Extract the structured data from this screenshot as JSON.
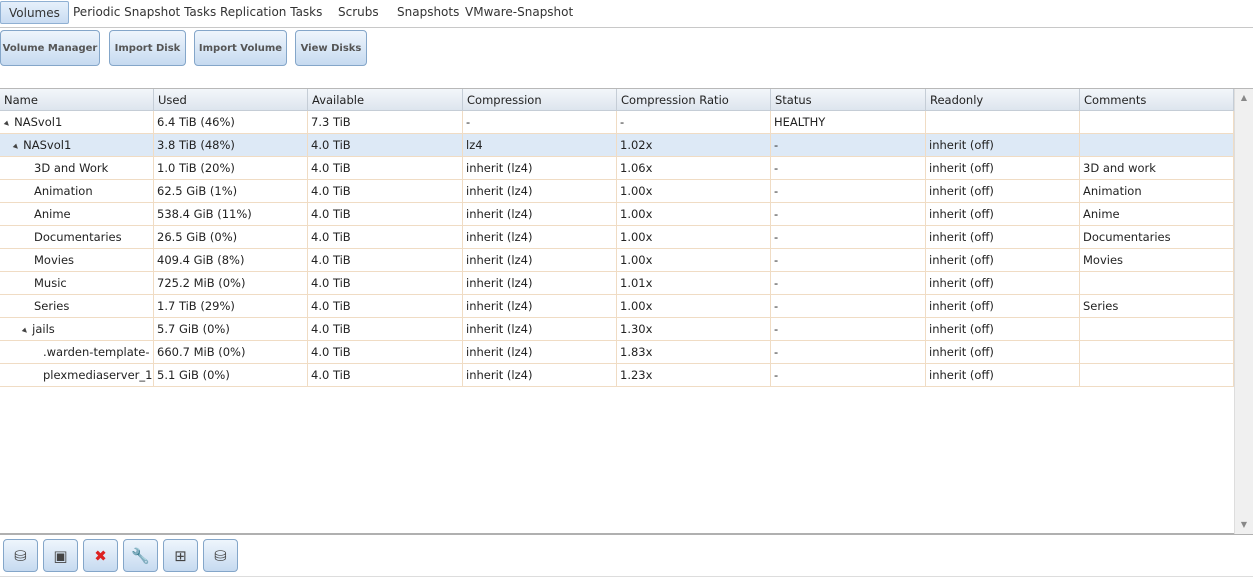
{
  "tabs": [
    "Volumes",
    "Periodic Snapshot Tasks",
    "Replication Tasks",
    "Scrubs",
    "Snapshots",
    "VMware-Snapshot"
  ],
  "buttons": [
    "Volume Manager",
    "Import Disk",
    "Import Volume",
    "View Disks"
  ],
  "columns": [
    "Name",
    "Used",
    "Available",
    "Compression",
    "Compression Ratio",
    "Status",
    "Readonly",
    "Comments"
  ],
  "rows": [
    {
      "level": 0,
      "toggle": "▲",
      "name": "NASvol1",
      "used": "6.4 TiB (46%)",
      "available": "7.3 TiB",
      "compression": "-",
      "ratio": "-",
      "status": "HEALTHY",
      "readonly": "",
      "comments": ""
    },
    {
      "level": 1,
      "toggle": "▲",
      "name": "NASvol1",
      "used": "3.8 TiB (48%)",
      "available": "4.0 TiB",
      "compression": "lz4",
      "ratio": "1.02x",
      "status": "-",
      "readonly": "inherit (off)",
      "comments": ""
    },
    {
      "level": 2,
      "name": "3D and Work",
      "used": "1.0 TiB (20%)",
      "available": "4.0 TiB",
      "compression": "inherit (lz4)",
      "ratio": "1.06x",
      "status": "-",
      "readonly": "inherit (off)",
      "comments": "3D and work"
    },
    {
      "level": 2,
      "name": "Animation",
      "used": "62.5 GiB (1%)",
      "available": "4.0 TiB",
      "compression": "inherit (lz4)",
      "ratio": "1.00x",
      "status": "-",
      "readonly": "inherit (off)",
      "comments": "Animation"
    },
    {
      "level": 2,
      "name": "Anime",
      "used": "538.4 GiB (11%)",
      "available": "4.0 TiB",
      "compression": "inherit (lz4)",
      "ratio": "1.00x",
      "status": "-",
      "readonly": "inherit (off)",
      "comments": "Anime"
    },
    {
      "level": 2,
      "name": "Documentaries",
      "used": "26.5 GiB (0%)",
      "available": "4.0 TiB",
      "compression": "inherit (lz4)",
      "ratio": "1.00x",
      "status": "-",
      "readonly": "inherit (off)",
      "comments": "Documentaries"
    },
    {
      "level": 2,
      "name": "Movies",
      "used": "409.4 GiB (8%)",
      "available": "4.0 TiB",
      "compression": "inherit (lz4)",
      "ratio": "1.00x",
      "status": "-",
      "readonly": "inherit (off)",
      "comments": "Movies"
    },
    {
      "level": 2,
      "name": "Music",
      "used": "725.2 MiB (0%)",
      "available": "4.0 TiB",
      "compression": "inherit (lz4)",
      "ratio": "1.01x",
      "status": "-",
      "readonly": "inherit (off)",
      "comments": ""
    },
    {
      "level": 2,
      "name": "Series",
      "used": "1.7 TiB (29%)",
      "available": "4.0 TiB",
      "compression": "inherit (lz4)",
      "ratio": "1.00x",
      "status": "-",
      "readonly": "inherit (off)",
      "comments": "Series"
    },
    {
      "level": 2,
      "toggle": "▲",
      "name": "jails",
      "used": "5.7 GiB (0%)",
      "available": "4.0 TiB",
      "compression": "inherit (lz4)",
      "ratio": "1.30x",
      "status": "-",
      "readonly": "inherit (off)",
      "comments": ""
    },
    {
      "level": 3,
      "name": ".warden-template-",
      "used": "660.7 MiB (0%)",
      "available": "4.0 TiB",
      "compression": "inherit (lz4)",
      "ratio": "1.83x",
      "status": "-",
      "readonly": "inherit (off)",
      "comments": ""
    },
    {
      "level": 3,
      "name": "plexmediaserver_1",
      "used": "5.1 GiB (0%)",
      "available": "4.0 TiB",
      "compression": "inherit (lz4)",
      "ratio": "1.23x",
      "status": "-",
      "readonly": "inherit (off)",
      "comments": ""
    }
  ],
  "selected_row": 1,
  "bottom_icons": [
    "change-passphrase-icon",
    "create-zvol-icon",
    "destroy-volume-icon",
    "edit-options-icon",
    "create-dataset-icon",
    "volume-status-icon"
  ]
}
